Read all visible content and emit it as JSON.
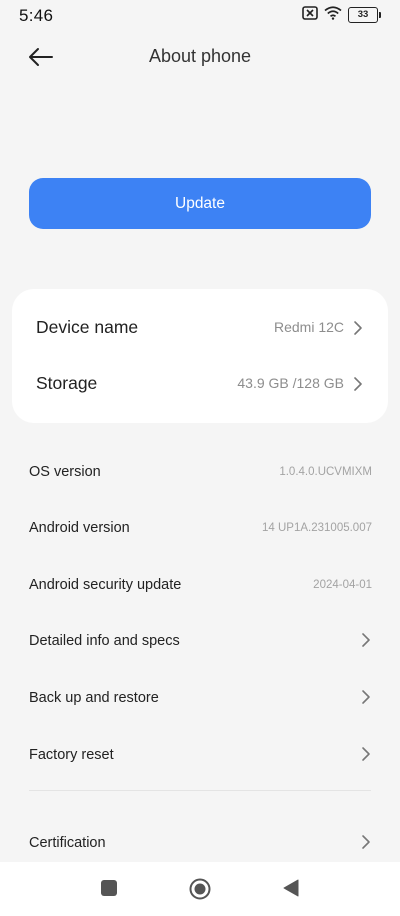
{
  "status_bar": {
    "time": "5:46",
    "battery_level": "33",
    "icons": [
      "no-sim-icon",
      "wifi-icon",
      "battery-icon"
    ]
  },
  "header": {
    "title": "About phone",
    "back_icon": "back-arrow-icon"
  },
  "update_button": {
    "label": "Update",
    "color": "#3d82f4"
  },
  "device_card": {
    "rows": [
      {
        "label": "Device name",
        "value": "Redmi 12C"
      },
      {
        "label": "Storage",
        "value": "43.9 GB /128 GB"
      }
    ]
  },
  "info_list": {
    "rows": [
      {
        "label": "OS version",
        "value": "1.0.4.0.UCVMIXM"
      },
      {
        "label": "Android version",
        "value": "14 UP1A.231005.007"
      },
      {
        "label": "Android security update",
        "value": "2024-04-01"
      },
      {
        "label": "Detailed info and specs"
      },
      {
        "label": "Back up and restore"
      },
      {
        "label": "Factory reset"
      },
      {
        "label": "Certification"
      }
    ]
  },
  "nav_bar": {
    "icons": [
      "recents-square-icon",
      "home-circle-icon",
      "back-triangle-icon"
    ]
  }
}
